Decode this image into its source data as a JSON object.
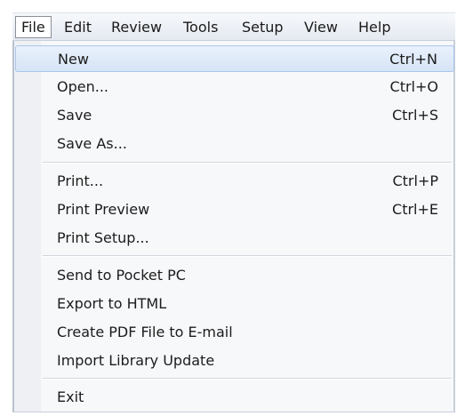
{
  "menubar": {
    "items": [
      {
        "label": "File"
      },
      {
        "label": "Edit"
      },
      {
        "label": "Review"
      },
      {
        "label": "Tools"
      },
      {
        "label": "Setup"
      },
      {
        "label": "View"
      },
      {
        "label": "Help"
      }
    ]
  },
  "file_menu": {
    "items": [
      {
        "label": "New",
        "shortcut": "Ctrl+N"
      },
      {
        "label": "Open...",
        "shortcut": "Ctrl+O"
      },
      {
        "label": "Save",
        "shortcut": "Ctrl+S"
      },
      {
        "label": "Save As...",
        "shortcut": ""
      },
      {
        "label": "Print...",
        "shortcut": "Ctrl+P"
      },
      {
        "label": "Print Preview",
        "shortcut": "Ctrl+E"
      },
      {
        "label": "Print Setup...",
        "shortcut": ""
      },
      {
        "label": "Send to Pocket PC",
        "shortcut": ""
      },
      {
        "label": "Export to HTML",
        "shortcut": ""
      },
      {
        "label": "Create PDF File to E-mail",
        "shortcut": ""
      },
      {
        "label": "Import Library Update",
        "shortcut": ""
      },
      {
        "label": "Exit",
        "shortcut": ""
      }
    ]
  },
  "colors": {
    "highlight_background": "#dbe8f8",
    "highlight_border": "#a9c6ec",
    "menu_background": "#f7f8fa",
    "text": "#1c1c1c"
  }
}
